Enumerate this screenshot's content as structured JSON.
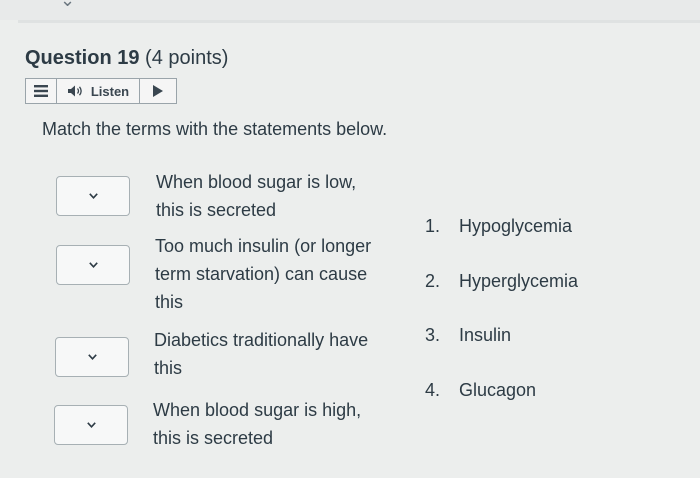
{
  "question": {
    "label": "Question 19",
    "points": "(4 points)",
    "prompt": "Match the terms with the statements below."
  },
  "toolbar": {
    "listen_label": "Listen",
    "icons": [
      "menu-icon",
      "speaker-icon",
      "play-icon"
    ]
  },
  "statements": [
    {
      "lines": [
        "When blood sugar is low,",
        "this is secreted"
      ]
    },
    {
      "lines": [
        "Too much insulin (or longer",
        "term starvation) can cause",
        "this"
      ]
    },
    {
      "lines": [
        "Diabetics traditionally have",
        "this"
      ]
    },
    {
      "lines": [
        "When blood sugar is high,",
        "this is secreted"
      ]
    }
  ],
  "options": [
    {
      "number": "1.",
      "text": "Hypoglycemia"
    },
    {
      "number": "2.",
      "text": "Hyperglycemia"
    },
    {
      "number": "3.",
      "text": "Insulin"
    },
    {
      "number": "4.",
      "text": "Glucagon"
    }
  ],
  "colors": {
    "text": "#2d3b45",
    "background": "#eceeed",
    "border": "#a7b0b4"
  }
}
